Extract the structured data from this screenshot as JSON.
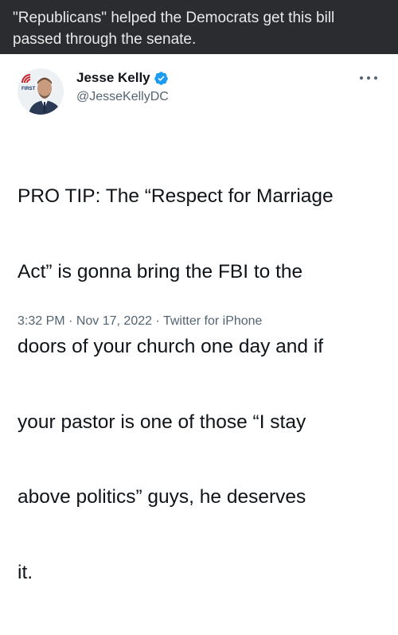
{
  "caption": {
    "line1": "\"Republicans\" helped the Democrats get this bill",
    "line2": "passed through the senate."
  },
  "tweet": {
    "author": {
      "name": "Jesse Kelly",
      "handle": "@JesseKellyDC",
      "verified": true,
      "avatar_badge": "FIRST"
    },
    "text_lines": [
      "PRO TIP: The “Respect for Marriage",
      "Act” is gonna bring the FBI to the",
      "doors of your church one day and if",
      "your pastor is one of those “I stay",
      "above politics” guys, he deserves",
      "it."
    ],
    "time": "3:32 PM",
    "date": "Nov 17, 2022",
    "source": "Twitter for iPhone",
    "separator": "·"
  },
  "colors": {
    "caption_bg": "#2a2c2f",
    "verified_blue": "#1d9bf0",
    "secondary_text": "#536471",
    "primary_text": "#0f1419"
  },
  "icons": [
    "verified-badge-icon",
    "more-options-icon"
  ]
}
